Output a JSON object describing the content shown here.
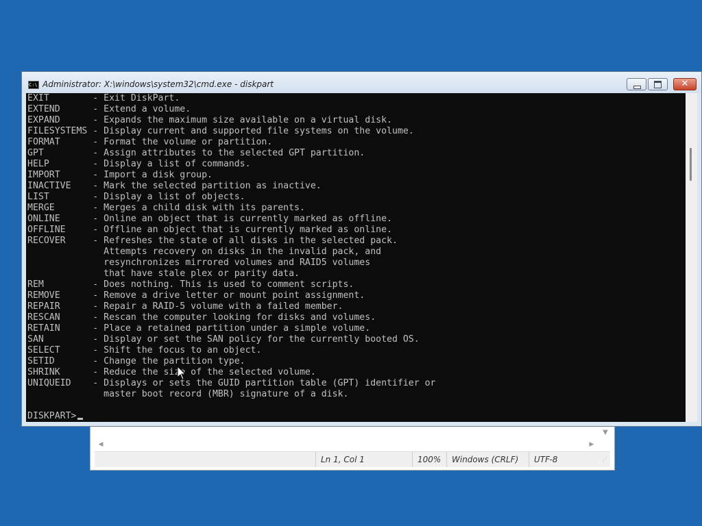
{
  "cmd_window": {
    "title": "Administrator: X:\\windows\\system32\\cmd.exe - diskpart",
    "icon_label": "C:\\",
    "controls": {
      "minimize": "minimize-icon",
      "maximize": "maximize-icon",
      "close_glyph": "✕"
    }
  },
  "console": {
    "lines": [
      "EXIT        - Exit DiskPart.",
      "EXTEND      - Extend a volume.",
      "EXPAND      - Expands the maximum size available on a virtual disk.",
      "FILESYSTEMS - Display current and supported file systems on the volume.",
      "FORMAT      - Format the volume or partition.",
      "GPT         - Assign attributes to the selected GPT partition.",
      "HELP        - Display a list of commands.",
      "IMPORT      - Import a disk group.",
      "INACTIVE    - Mark the selected partition as inactive.",
      "LIST        - Display a list of objects.",
      "MERGE       - Merges a child disk with its parents.",
      "ONLINE      - Online an object that is currently marked as offline.",
      "OFFLINE     - Offline an object that is currently marked as online.",
      "RECOVER     - Refreshes the state of all disks in the selected pack.",
      "              Attempts recovery on disks in the invalid pack, and",
      "              resynchronizes mirrored volumes and RAID5 volumes",
      "              that have stale plex or parity data.",
      "REM         - Does nothing. This is used to comment scripts.",
      "REMOVE      - Remove a drive letter or mount point assignment.",
      "REPAIR      - Repair a RAID-5 volume with a failed member.",
      "RESCAN      - Rescan the computer looking for disks and volumes.",
      "RETAIN      - Place a retained partition under a simple volume.",
      "SAN         - Display or set the SAN policy for the currently booted OS.",
      "SELECT      - Shift the focus to an object.",
      "SETID       - Change the partition type.",
      "SHRINK      - Reduce the size of the selected volume.",
      "UNIQUEID    - Displays or sets the GUID partition table (GPT) identifier or",
      "              master boot record (MBR) signature of a disk.",
      ""
    ],
    "prompt": "DISKPART>"
  },
  "notepad": {
    "status": {
      "position": "Ln 1, Col 1",
      "zoom": "100%",
      "line_endings": "Windows (CRLF)",
      "encoding": "UTF-8"
    },
    "scroll_icons": {
      "down": "▼",
      "left": "◀",
      "right": "▶",
      "grip": "⋰"
    }
  },
  "colors": {
    "desktop": "#1f67b1",
    "console_bg": "#0c0c0c",
    "console_text": "#c0c0c0",
    "close_button": "#c7432a"
  }
}
